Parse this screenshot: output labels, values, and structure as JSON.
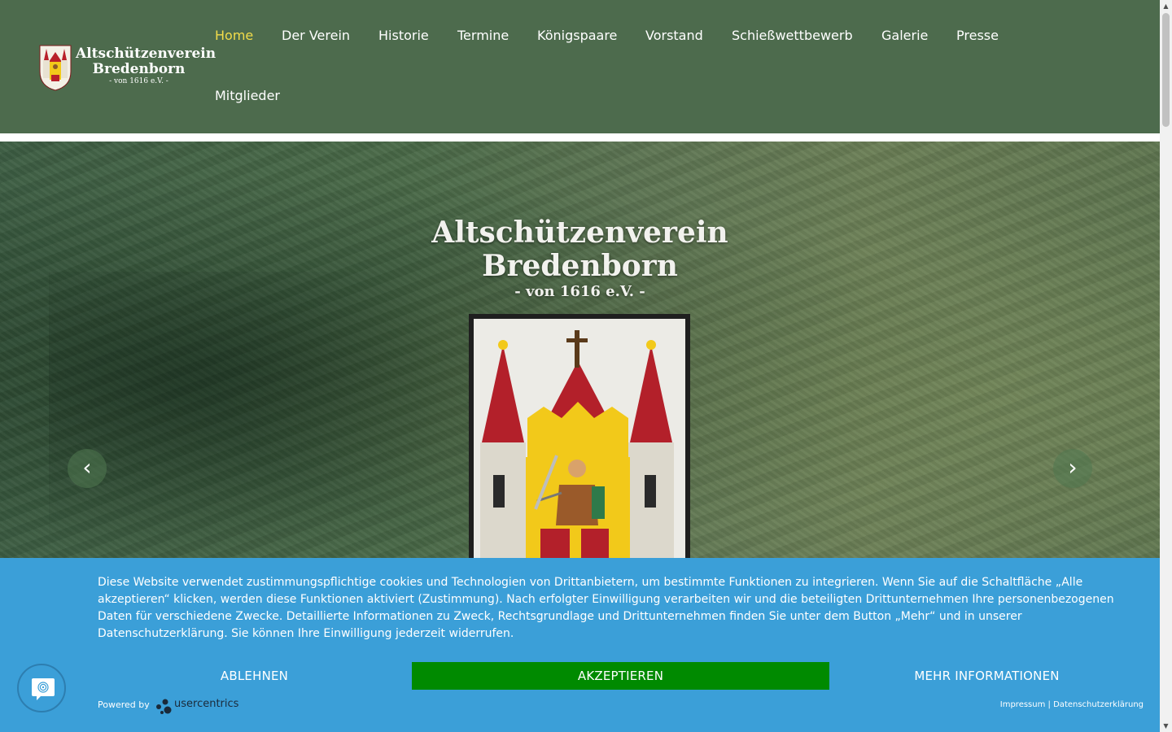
{
  "header": {
    "logo": {
      "line1": "Altschützenverein",
      "line2": "Bredenborn",
      "line3": "- von 1616 e.V. -"
    },
    "nav": [
      {
        "label": "Home",
        "active": true
      },
      {
        "label": "Der Verein"
      },
      {
        "label": "Historie"
      },
      {
        "label": "Termine"
      },
      {
        "label": "Königspaare"
      },
      {
        "label": "Vorstand"
      },
      {
        "label": "Schießwettbewerb"
      },
      {
        "label": "Galerie"
      },
      {
        "label": "Presse"
      },
      {
        "label": "Mitglieder"
      }
    ]
  },
  "hero": {
    "title_line1": "Altschützenverein",
    "title_line2": "Bredenborn",
    "title_line3": "- von 1616 e.V. -",
    "prev_icon": "chevron-left-icon",
    "next_icon": "chevron-right-icon",
    "prev_glyph": "‹",
    "next_glyph": "›"
  },
  "cookie": {
    "text": "Diese Website verwendet zustimmungspflichtige cookies und Technologien von Drittanbietern, um bestimmte Funktionen zu integrieren. Wenn Sie auf die Schaltfläche „Alle akzeptieren“ klicken, werden diese Funktionen aktiviert (Zustimmung). Nach erfolgter Einwilligung verarbeiten wir und die beteiligten Drittunternehmen Ihre personenbezogenen Daten für verschiedene Zwecke. Detaillierte Informationen zu Zweck, Rechtsgrundlage und Drittunternehmen finden Sie unter dem Button „Mehr“ und in unserer Datenschutzerklärung. Sie können Ihre Einwilligung jederzeit widerrufen.",
    "decline_label": "ABLEHNEN",
    "accept_label": "AKZEPTIEREN",
    "more_label": "MEHR INFORMATIONEN",
    "powered_by": "Powered by",
    "brand": "usercentrics",
    "impressum": "Impressum",
    "separator": "|",
    "datenschutz": "Datenschutzerklärung"
  },
  "colors": {
    "header_bg": "#4d6b4d",
    "nav_active": "#f2dc4a",
    "banner_bg": "#3b9fd8",
    "accept_bg": "#008a00"
  },
  "icons": {
    "privacy_button": "fingerprint-icon"
  }
}
